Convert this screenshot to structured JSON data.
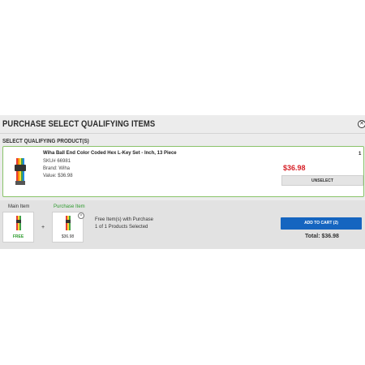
{
  "header": {
    "title": "PURCHASE SELECT QUALIFYING ITEMS",
    "close_icon": "close-circle-icon"
  },
  "section": {
    "title": "SELECT QUALIFYING PRODUCT(S)"
  },
  "product": {
    "name": "Wiha Ball End Color Coded Hex L-Key Set - Inch, 13 Piece",
    "sku": "SKU# 66981",
    "brand": "Brand: Wiha",
    "value": "Value: $36.98",
    "price": "$36.98",
    "quantity": "1",
    "unselect_label": "UNSELECT",
    "image_icon": "hex-key-set-icon"
  },
  "footer": {
    "main_item_label": "Main Item",
    "main_item_price": "FREE",
    "plus": "+",
    "purchase_item_label": "Purchase Item",
    "purchase_item_price": "$36.98",
    "free_items_text": "Free Item(s) with Purchase",
    "selected_text": "1 of 1 Products Selected",
    "add_to_cart_label": "ADD TO CART (2)",
    "total_text": "Total: $36.98"
  },
  "colors": {
    "accent": "#1565c0",
    "price": "#d62027",
    "free": "#2e9b2e",
    "selected_border": "#8ac36a"
  }
}
